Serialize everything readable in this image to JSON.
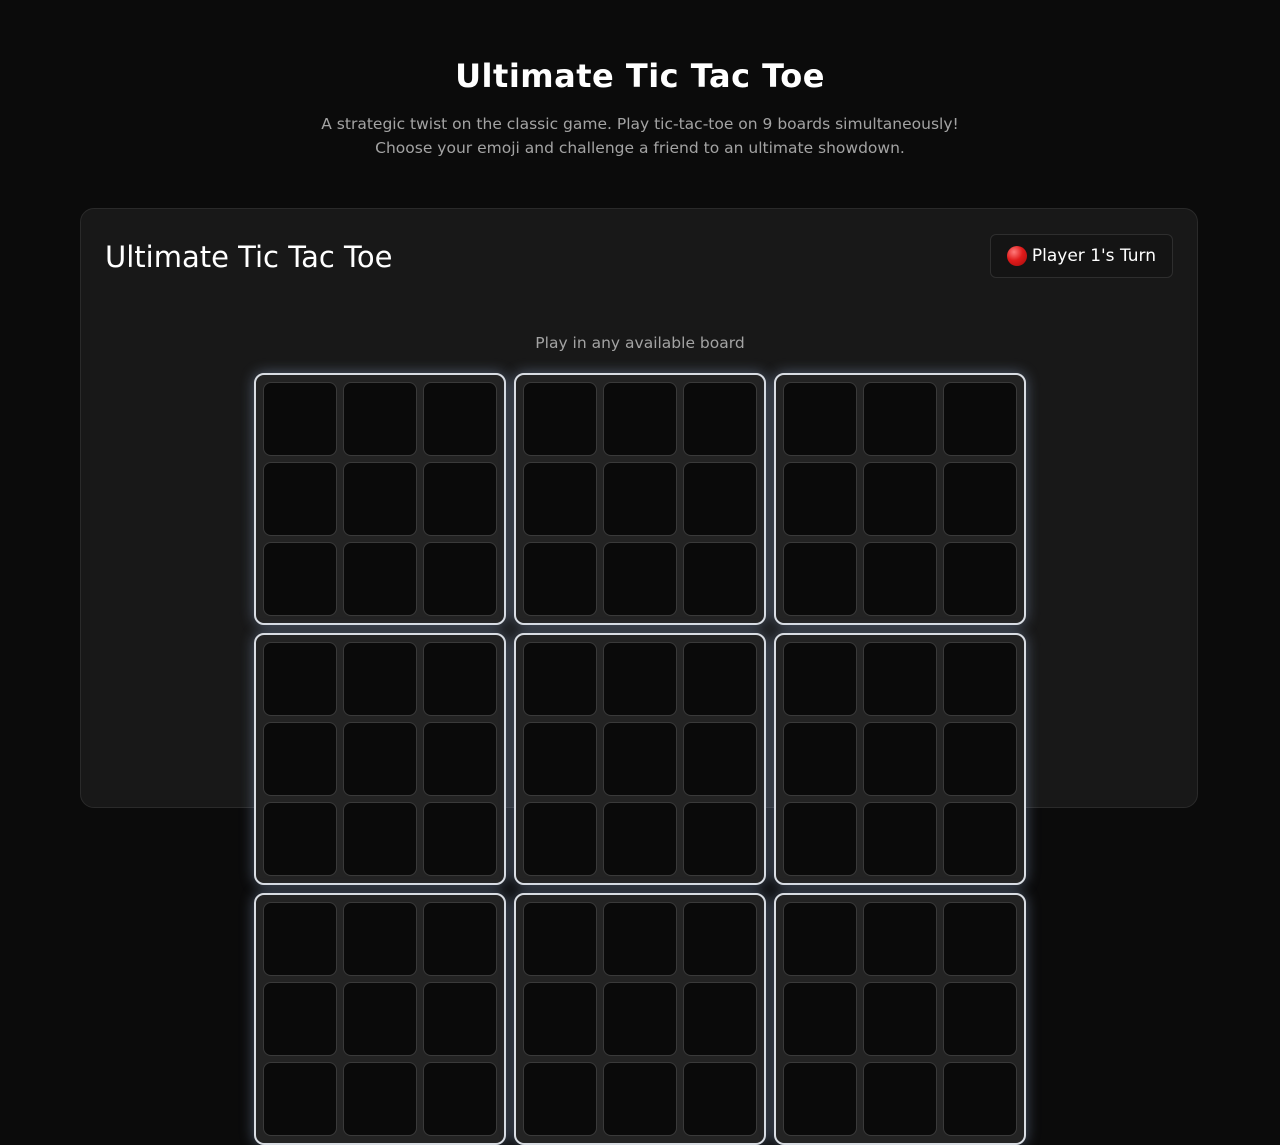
{
  "hero": {
    "title": "Ultimate Tic Tac Toe",
    "description": "A strategic twist on the classic game. Play tic-tac-toe on 9 boards simultaneously! Choose your emoji and challenge a friend to an ultimate showdown."
  },
  "game": {
    "title": "Ultimate Tic Tac Toe",
    "turn_indicator": {
      "icon": "red-circle-emoji",
      "label": "Player 1's Turn"
    },
    "hint": "Play in any available board",
    "boards_total": 9,
    "cells_per_board": 9,
    "cells": [
      [
        "",
        "",
        "",
        "",
        "",
        "",
        "",
        "",
        ""
      ],
      [
        "",
        "",
        "",
        "",
        "",
        "",
        "",
        "",
        ""
      ],
      [
        "",
        "",
        "",
        "",
        "",
        "",
        "",
        "",
        ""
      ],
      [
        "",
        "",
        "",
        "",
        "",
        "",
        "",
        "",
        ""
      ],
      [
        "",
        "",
        "",
        "",
        "",
        "",
        "",
        "",
        ""
      ],
      [
        "",
        "",
        "",
        "",
        "",
        "",
        "",
        "",
        ""
      ],
      [
        "",
        "",
        "",
        "",
        "",
        "",
        "",
        "",
        ""
      ],
      [
        "",
        "",
        "",
        "",
        "",
        "",
        "",
        "",
        ""
      ],
      [
        "",
        "",
        "",
        "",
        "",
        "",
        "",
        "",
        ""
      ]
    ]
  },
  "colors": {
    "background": "#0b0b0b",
    "card": "#181818",
    "cell": "#0a0a0a",
    "active_board_border": "#d9dde3",
    "muted_text": "#a3a3a3",
    "player1": "#e01b1b"
  }
}
